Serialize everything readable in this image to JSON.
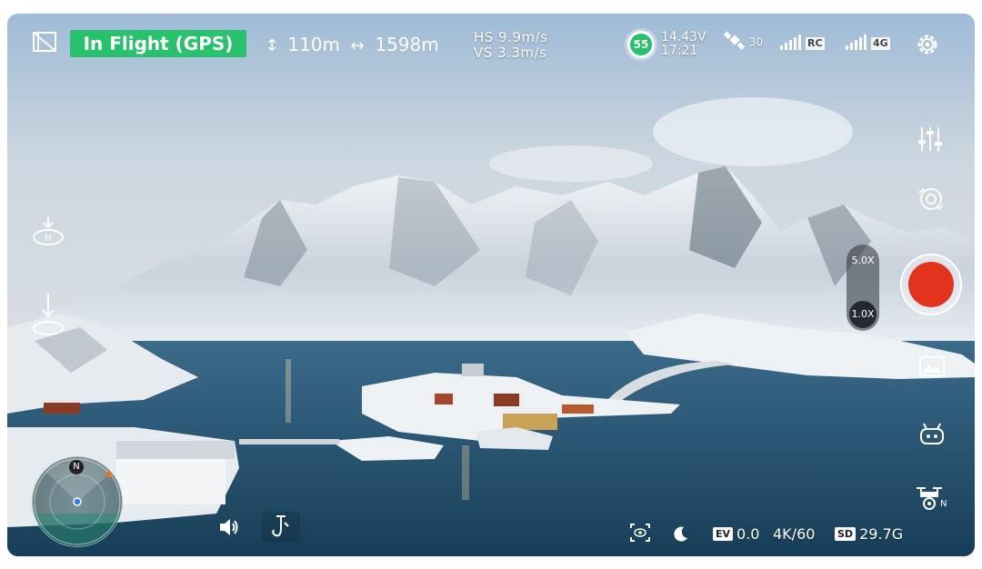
{
  "status": {
    "label": "In Flight (GPS)",
    "color": "#27c26b"
  },
  "altitude": {
    "value": "110m",
    "icon": "altitude-arrows-icon"
  },
  "distance": {
    "value": "1598m",
    "icon": "distance-arrows-icon"
  },
  "speed": {
    "hs_label": "HS",
    "hs_value": "9.9m/s",
    "vs_label": "VS",
    "vs_value": "3.3m/s"
  },
  "battery": {
    "percent": "55",
    "voltage": "14.43V",
    "time": "17:21"
  },
  "gps": {
    "count": "30"
  },
  "rc": {
    "label": "RC"
  },
  "net": {
    "label": "4G"
  },
  "zoom": {
    "options": [
      "5.0X",
      "1.0X"
    ],
    "selected": "1.0X"
  },
  "radar": {
    "north": "N"
  },
  "bottom": {
    "ev_label": "EV",
    "ev_value": "0.0",
    "resolution": "4K/60",
    "sd_label": "SD",
    "storage": "29.7G"
  },
  "right_panel": {
    "drone_mode_label": "N"
  },
  "colors": {
    "record": "#e3331d",
    "accent": "#27c26b"
  }
}
